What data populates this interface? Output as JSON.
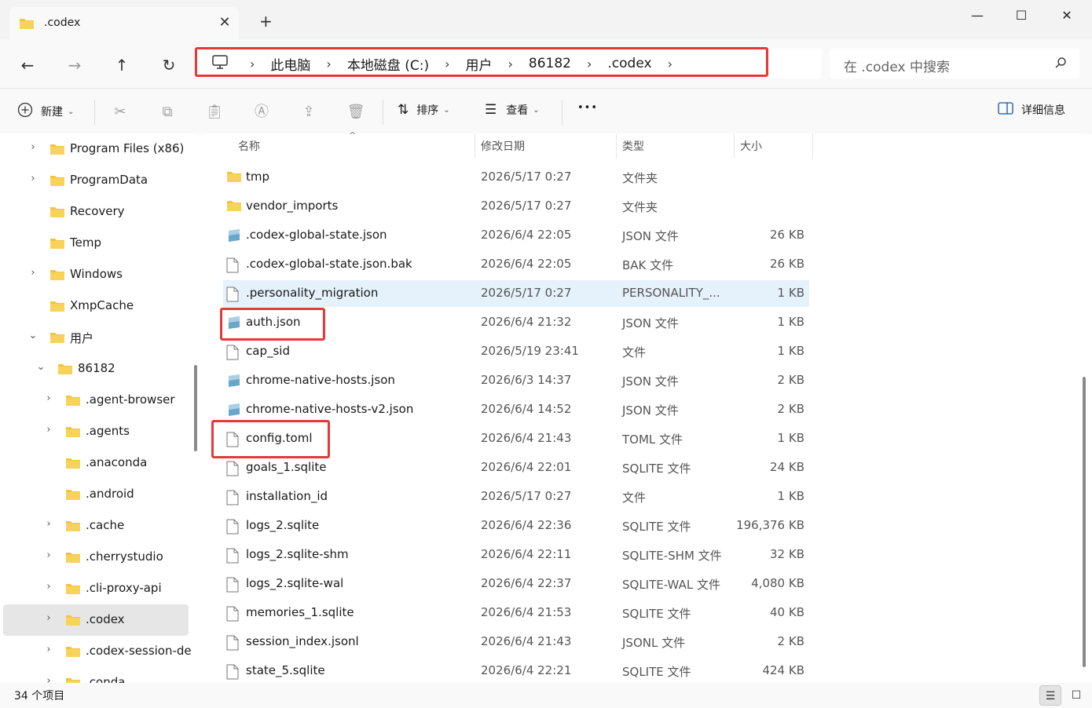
{
  "tab": {
    "title": ".codex",
    "close": "✕",
    "new": "+"
  },
  "window": {
    "minimize": "—",
    "maximize": "☐",
    "close": "✕"
  },
  "nav": {
    "back": "←",
    "forward": "→",
    "up": "↑",
    "refresh": "↻"
  },
  "breadcrumb": [
    "此电脑",
    "本地磁盘 (C:)",
    "用户",
    "86182",
    ".codex"
  ],
  "breadcrumb_sep": "›",
  "search": {
    "placeholder": "在 .codex 中搜索"
  },
  "toolbar": {
    "new_label": "新建",
    "sort_label": "排序",
    "view_label": "查看",
    "more": "•••",
    "details_label": "详细信息"
  },
  "sidebar": {
    "items": [
      {
        "label": "Program Files (x86)",
        "expander": "›"
      },
      {
        "label": "ProgramData",
        "expander": "›"
      },
      {
        "label": "Recovery",
        "expander": ""
      },
      {
        "label": "Temp",
        "expander": ""
      },
      {
        "label": "Windows",
        "expander": "›"
      },
      {
        "label": "XmpCache",
        "expander": ""
      },
      {
        "label": "用户",
        "expander": "⌄"
      },
      {
        "label": "86182",
        "expander": "⌄"
      },
      {
        "label": ".agent-browser",
        "expander": "›"
      },
      {
        "label": ".agents",
        "expander": "›"
      },
      {
        "label": ".anaconda",
        "expander": ""
      },
      {
        "label": ".android",
        "expander": ""
      },
      {
        "label": ".cache",
        "expander": "›"
      },
      {
        "label": ".cherrystudio",
        "expander": "›"
      },
      {
        "label": ".cli-proxy-api",
        "expander": "›"
      },
      {
        "label": ".codex",
        "expander": "›"
      },
      {
        "label": ".codex-session-de",
        "expander": "›"
      },
      {
        "label": ".conda",
        "expander": "›"
      }
    ]
  },
  "columns": {
    "name": "名称",
    "date": "修改日期",
    "type": "类型",
    "size": "大小",
    "sort_indicator": "^"
  },
  "files": [
    {
      "name": "tmp",
      "date": "2026/5/17 0:27",
      "type": "文件夹",
      "size": "",
      "icon": "folder-icon"
    },
    {
      "name": "vendor_imports",
      "date": "2026/5/17 0:27",
      "type": "文件夹",
      "size": "",
      "icon": "folder-icon"
    },
    {
      "name": ".codex-global-state.json",
      "date": "2026/6/4 22:05",
      "type": "JSON 文件",
      "size": "26 KB",
      "icon": "json-file-icon"
    },
    {
      "name": ".codex-global-state.json.bak",
      "date": "2026/6/4 22:05",
      "type": "BAK 文件",
      "size": "26 KB",
      "icon": "file-icon"
    },
    {
      "name": ".personality_migration",
      "date": "2026/5/17 0:27",
      "type": "PERSONALITY_...",
      "size": "1 KB",
      "icon": "file-icon"
    },
    {
      "name": "auth.json",
      "date": "2026/6/4 21:32",
      "type": "JSON 文件",
      "size": "1 KB",
      "icon": "json-file-icon"
    },
    {
      "name": "cap_sid",
      "date": "2026/5/19 23:41",
      "type": "文件",
      "size": "1 KB",
      "icon": "file-icon"
    },
    {
      "name": "chrome-native-hosts.json",
      "date": "2026/6/3 14:37",
      "type": "JSON 文件",
      "size": "2 KB",
      "icon": "json-file-icon"
    },
    {
      "name": "chrome-native-hosts-v2.json",
      "date": "2026/6/4 14:52",
      "type": "JSON 文件",
      "size": "2 KB",
      "icon": "json-file-icon"
    },
    {
      "name": "config.toml",
      "date": "2026/6/4 21:43",
      "type": "TOML 文件",
      "size": "1 KB",
      "icon": "file-icon"
    },
    {
      "name": "goals_1.sqlite",
      "date": "2026/6/4 22:01",
      "type": "SQLITE 文件",
      "size": "24 KB",
      "icon": "file-icon"
    },
    {
      "name": "installation_id",
      "date": "2026/5/17 0:27",
      "type": "文件",
      "size": "1 KB",
      "icon": "file-icon"
    },
    {
      "name": "logs_2.sqlite",
      "date": "2026/6/4 22:36",
      "type": "SQLITE 文件",
      "size": "196,376 KB",
      "icon": "file-icon"
    },
    {
      "name": "logs_2.sqlite-shm",
      "date": "2026/6/4 22:11",
      "type": "SQLITE-SHM 文件",
      "size": "32 KB",
      "icon": "file-icon"
    },
    {
      "name": "logs_2.sqlite-wal",
      "date": "2026/6/4 22:37",
      "type": "SQLITE-WAL 文件",
      "size": "4,080 KB",
      "icon": "file-icon"
    },
    {
      "name": "memories_1.sqlite",
      "date": "2026/6/4 21:53",
      "type": "SQLITE 文件",
      "size": "40 KB",
      "icon": "file-icon"
    },
    {
      "name": "session_index.jsonl",
      "date": "2026/6/4 21:43",
      "type": "JSONL 文件",
      "size": "2 KB",
      "icon": "file-icon"
    },
    {
      "name": "state_5.sqlite",
      "date": "2026/6/4 22:21",
      "type": "SQLITE 文件",
      "size": "424 KB",
      "icon": "file-icon"
    }
  ],
  "status": {
    "count": "34 个项目"
  },
  "colors": {
    "highlight": "#e53935",
    "folder": "#f3c33d",
    "hover_row": "#e5f1fb",
    "selected_tree": "#e6e6e6"
  }
}
